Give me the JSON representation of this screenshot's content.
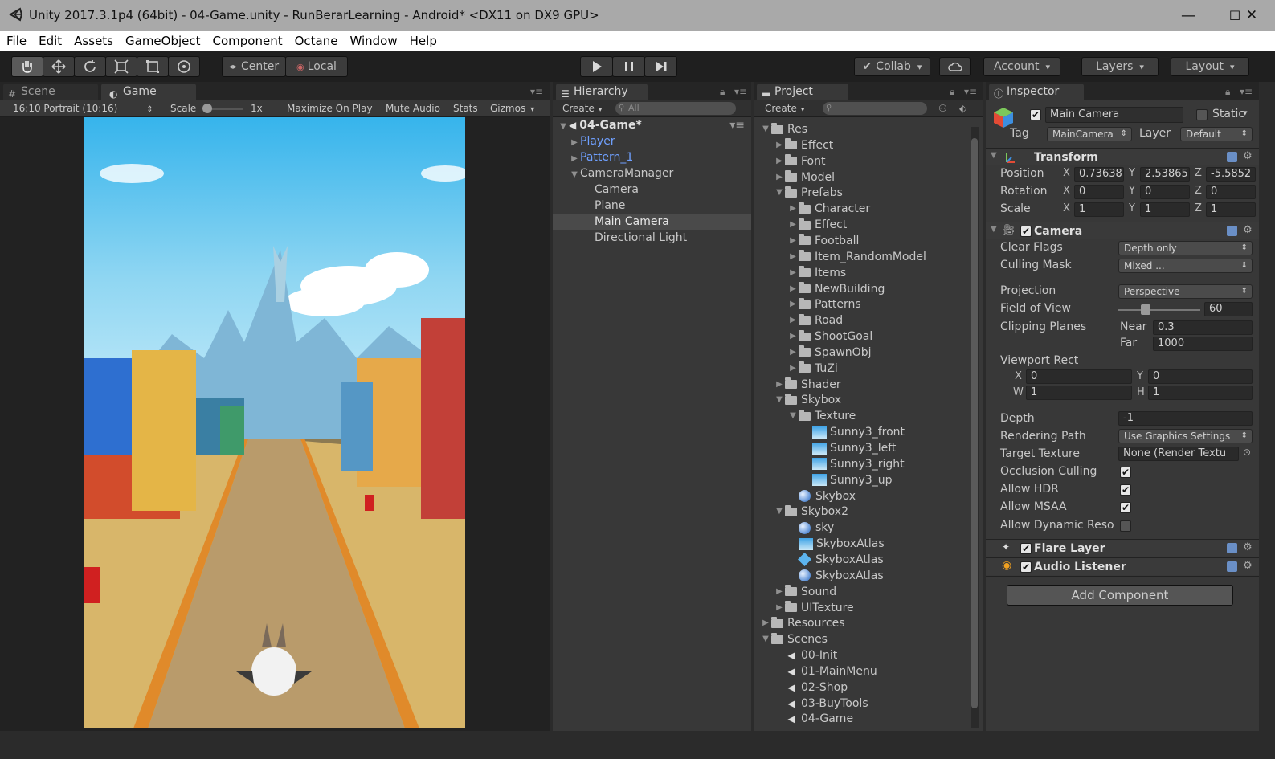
{
  "window": {
    "title": "Unity 2017.3.1p4 (64bit) - 04-Game.unity - RunBerarLearning - Android* <DX11 on DX9 GPU>",
    "minimize": "—",
    "maximize": "☐",
    "close": "✕"
  },
  "menu": [
    "File",
    "Edit",
    "Assets",
    "GameObject",
    "Component",
    "Octane",
    "Window",
    "Help"
  ],
  "toolbar": {
    "pivot": "Center",
    "space": "Local",
    "collab": "Collab",
    "account": "Account",
    "layers": "Layers",
    "layout": "Layout",
    "colors": {
      "play_icon": "#d8d8d8"
    }
  },
  "game": {
    "tab_scene": "Scene",
    "tab_game": "Game",
    "aspect": "16:10 Portrait (10:16)",
    "scale_label": "Scale",
    "scale_value": "1x",
    "maximize": "Maximize On Play",
    "mute": "Mute Audio",
    "stats": "Stats",
    "gizmos": "Gizmos"
  },
  "hierarchy": {
    "tab": "Hierarchy",
    "create": "Create",
    "search_placeholder": "All",
    "scene": "04-Game*",
    "items": [
      {
        "label": "Player",
        "color": "#6fa0ff"
      },
      {
        "label": "Pattern_1",
        "color": "#6fa0ff"
      },
      {
        "label": "CameraManager",
        "color": "#c8c8c8"
      },
      {
        "label": "Camera",
        "color": "#c8c8c8"
      },
      {
        "label": "Plane",
        "color": "#c8c8c8"
      },
      {
        "label": "Main Camera",
        "color": "#e6e6e6"
      },
      {
        "label": "Directional Light",
        "color": "#c8c8c8"
      }
    ]
  },
  "project": {
    "tab": "Project",
    "create": "Create",
    "items": [
      "Res",
      "Effect",
      "Font",
      "Model",
      "Prefabs",
      "Character",
      "Effect",
      "Football",
      "Item_RandomModel",
      "Items",
      "NewBuilding",
      "Patterns",
      "Road",
      "ShootGoal",
      "SpawnObj",
      "TuZi",
      "Shader",
      "Skybox",
      "Texture",
      "Sunny3_front",
      "Sunny3_left",
      "Sunny3_right",
      "Sunny3_up",
      "Skybox",
      "Skybox2",
      "sky",
      "SkyboxAtlas",
      "SkyboxAtlas",
      "SkyboxAtlas",
      "Sound",
      "UITexture",
      "Resources",
      "Scenes",
      "00-Init",
      "01-MainMenu",
      "02-Shop",
      "03-BuyTools",
      "04-Game"
    ]
  },
  "inspector": {
    "tab": "Inspector",
    "object_name": "Main Camera",
    "static": "Static",
    "tag_label": "Tag",
    "tag_value": "MainCamera",
    "layer_label": "Layer",
    "layer_value": "Default",
    "transform": {
      "title": "Transform",
      "position": "Position",
      "rotation": "Rotation",
      "scale": "Scale",
      "pos": [
        "0.73638",
        "2.53865",
        "-5.5852"
      ],
      "rot": [
        "0",
        "0",
        "0"
      ],
      "scl": [
        "1",
        "1",
        "1"
      ]
    },
    "camera": {
      "title": "Camera",
      "clear_flags": "Clear Flags",
      "clear_flags_value": "Depth only",
      "culling_mask": "Culling Mask",
      "culling_mask_value": "Mixed ...",
      "projection": "Projection",
      "projection_value": "Perspective",
      "fov": "Field of View",
      "fov_value": "60",
      "clipping": "Clipping Planes",
      "near": "Near",
      "near_value": "0.3",
      "far": "Far",
      "far_value": "1000",
      "viewport": "Viewport Rect",
      "vx": "0",
      "vy": "0",
      "vw": "1",
      "vh": "1",
      "depth": "Depth",
      "depth_value": "-1",
      "rendering": "Rendering Path",
      "rendering_value": "Use Graphics Settings",
      "target": "Target Texture",
      "target_value": "None (Render Textu",
      "occlusion": "Occlusion Culling",
      "hdr": "Allow HDR",
      "msaa": "Allow MSAA",
      "dynres": "Allow Dynamic Reso"
    },
    "flare": "Flare Layer",
    "audio": "Audio Listener",
    "add_component": "Add Component"
  }
}
